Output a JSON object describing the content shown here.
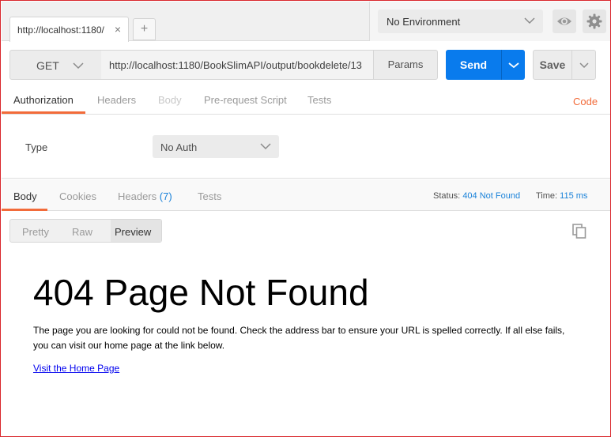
{
  "tabbar": {
    "tab_label": "http://localhost:1180/",
    "close_glyph": "×",
    "new_tab_glyph": "+"
  },
  "environment": {
    "selected": "No Environment",
    "icons": [
      "eye-icon",
      "gear-icon"
    ]
  },
  "request": {
    "method": "GET",
    "url": "http://localhost:1180/BookSlimAPI/output/bookdelete/13",
    "params_label": "Params",
    "send_label": "Send",
    "save_label": "Save"
  },
  "request_tabs": {
    "items": [
      "Authorization",
      "Headers",
      "Body",
      "Pre-request Script",
      "Tests"
    ],
    "active": "Authorization",
    "code_label": "Code"
  },
  "auth": {
    "type_label": "Type",
    "selected": "No Auth"
  },
  "response_tabs": {
    "body": "Body",
    "cookies": "Cookies",
    "headers": "Headers",
    "headers_count": "(7)",
    "tests": "Tests",
    "active": "Body"
  },
  "response_meta": {
    "status_label": "Status:",
    "status_value": "404 Not Found",
    "time_label": "Time:",
    "time_value": "115 ms"
  },
  "view_modes": {
    "pretty": "Pretty",
    "raw": "Raw",
    "preview": "Preview",
    "active": "Preview"
  },
  "preview": {
    "heading": "404 Page Not Found",
    "message": "The page you are looking for could not be found. Check the address bar to ensure your URL is spelled correctly. If all else fails, you can visit our home page at the link below.",
    "link_text": "Visit the Home Page"
  },
  "colors": {
    "accent": "#f26b3a",
    "send": "#097bed",
    "link_blue": "#1a82d9",
    "frame_border": "#d9262c"
  }
}
